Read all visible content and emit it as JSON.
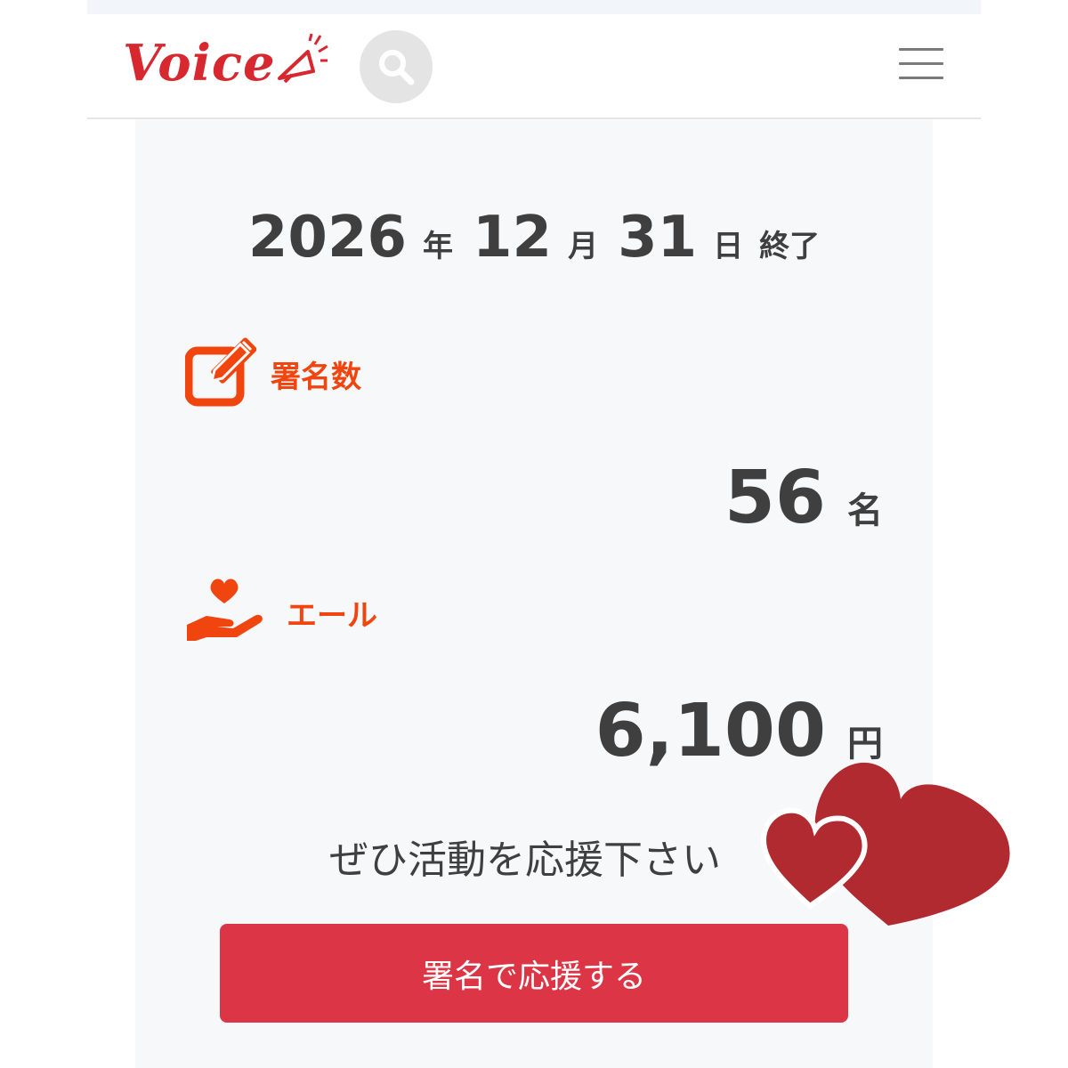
{
  "header": {
    "logo_text": "Voice",
    "logo_color": "#d7282f",
    "search_icon": "search-icon",
    "menu_icon": "hamburger-menu-icon"
  },
  "deadline": {
    "year": "2026",
    "year_unit": "年",
    "month": "12",
    "month_unit": "月",
    "day": "31",
    "day_unit": "日",
    "status": "終了"
  },
  "signatures": {
    "label": "署名数",
    "icon": "edit-pencil-icon",
    "count": "56",
    "unit": "名"
  },
  "cheer": {
    "label": "エール",
    "icon": "heart-hand-icon",
    "amount": "6,100",
    "unit": "円"
  },
  "message": "ぜひ活動を応援下さい",
  "cta": {
    "label": "署名で応援する",
    "color": "#dc3545"
  },
  "accent_color": "#f0450f"
}
